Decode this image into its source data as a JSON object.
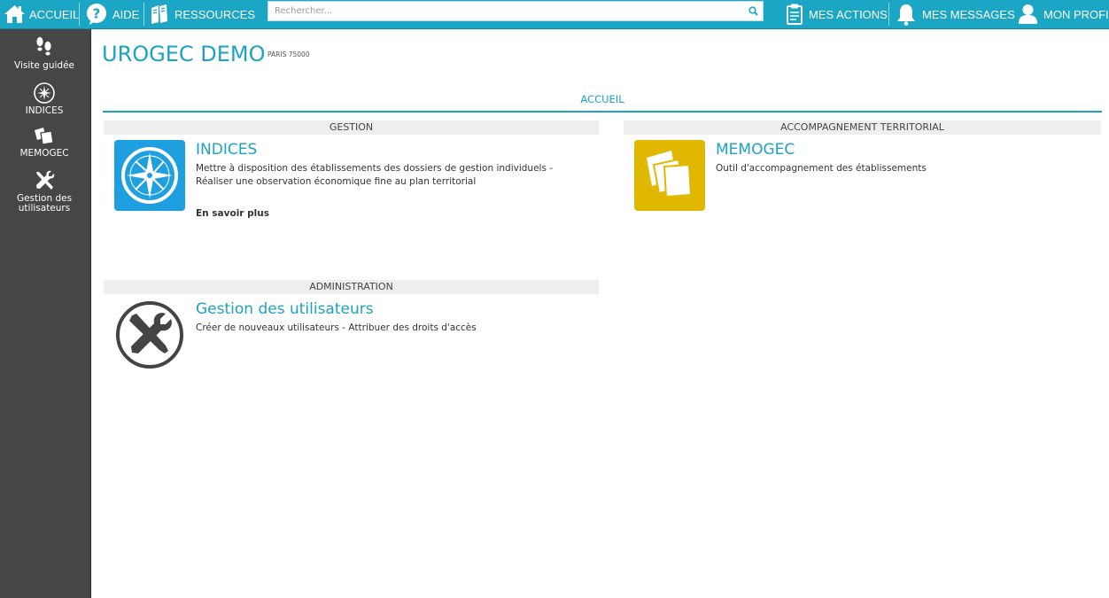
{
  "topbar": {
    "home_label": "ACCUEIL",
    "help_label": "AIDE",
    "resources_label": "RESSOURCES",
    "search_placeholder": "Rechercher...",
    "actions_label": "MES ACTIONS",
    "messages_label": "MES MESSAGES",
    "profile_label": "MON PROFIL",
    "accent_color": "#1aa6c4"
  },
  "sidebar": {
    "background_color": "#464646",
    "items": [
      {
        "label": "Visite guidée",
        "icon": "footprints-icon"
      },
      {
        "label": "INDICES",
        "icon": "compass-icon"
      },
      {
        "label": "MEMOGEC",
        "icon": "papers-icon"
      },
      {
        "label": "Gestion des utilisateurs",
        "icon": "wrench-screwdriver-icon"
      }
    ]
  },
  "main": {
    "org_name": "UROGEC DEMO",
    "org_location": "PARIS 75000",
    "active_tab": "ACCUEIL",
    "sections": {
      "gestion": {
        "title": "GESTION",
        "card": {
          "title": "INDICES",
          "description": "Mettre à disposition des établissements des dossiers de gestion individuels - Réaliser une observation économique fine au plan territorial",
          "more_link": "En savoir plus",
          "icon": "compass-icon",
          "icon_color": "#1e9fe0"
        }
      },
      "accompagnement": {
        "title": "ACCOMPAGNEMENT TERRITORIAL",
        "card": {
          "title": "MEMOGEC",
          "description": "Outil d'accompagnement des établissements",
          "icon": "papers-icon",
          "icon_color": "#e0b800"
        }
      },
      "administration": {
        "title": "ADMINISTRATION",
        "card": {
          "title": "Gestion des utilisateurs",
          "description": "Créer de nouveaux utilisateurs - Attribuer des droits d'accès",
          "icon": "wrench-screwdriver-icon"
        }
      }
    }
  }
}
